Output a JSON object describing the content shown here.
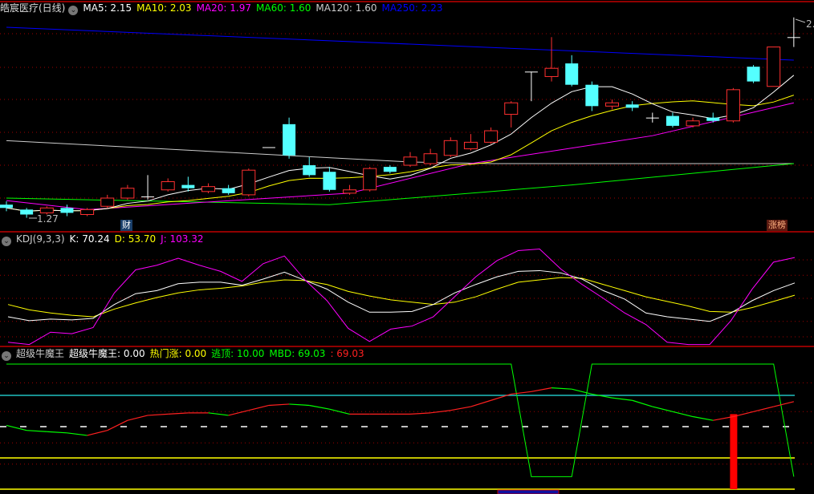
{
  "main": {
    "title": "皓宸医疗(日线)",
    "ma": [
      {
        "label": "MA5: 2.15",
        "color": "#ffffff"
      },
      {
        "label": "MA10: 2.03",
        "color": "#ffff00"
      },
      {
        "label": "MA20: 1.97",
        "color": "#ff00ff"
      },
      {
        "label": "MA60: 1.60",
        "color": "#00ff00"
      },
      {
        "label": "MA120: 1.60",
        "color": "#cccccc"
      },
      {
        "label": "MA250: 2.23",
        "color": "#0000ff"
      }
    ],
    "low_label": "1.27",
    "high_label": "2.",
    "badge_cai": "财",
    "badge_zhangbang": "涨榜",
    "candles": [
      [
        1.35,
        1.37,
        1.31,
        1.33
      ],
      [
        1.32,
        1.33,
        1.27,
        1.29
      ],
      [
        1.3,
        1.34,
        1.29,
        1.33
      ],
      [
        1.33,
        1.35,
        1.28,
        1.3
      ],
      [
        1.29,
        1.33,
        1.28,
        1.32
      ],
      [
        1.34,
        1.41,
        1.33,
        1.39
      ],
      [
        1.39,
        1.47,
        1.38,
        1.45
      ],
      [
        1.4,
        1.53,
        1.38,
        1.4
      ],
      [
        1.44,
        1.51,
        1.43,
        1.49
      ],
      [
        1.47,
        1.52,
        1.43,
        1.45
      ],
      [
        1.43,
        1.48,
        1.42,
        1.46
      ],
      [
        1.45,
        1.47,
        1.41,
        1.42
      ],
      [
        1.41,
        1.57,
        1.4,
        1.56
      ],
      [
        1.7,
        1.7,
        1.7,
        1.7
      ],
      [
        1.84,
        1.88,
        1.63,
        1.65
      ],
      [
        1.59,
        1.64,
        1.52,
        1.53
      ],
      [
        1.55,
        1.58,
        1.43,
        1.44
      ],
      [
        1.42,
        1.47,
        1.41,
        1.44
      ],
      [
        1.44,
        1.58,
        1.43,
        1.57
      ],
      [
        1.58,
        1.59,
        1.54,
        1.55
      ],
      [
        1.59,
        1.67,
        1.58,
        1.64
      ],
      [
        1.6,
        1.69,
        1.59,
        1.66
      ],
      [
        1.65,
        1.76,
        1.64,
        1.74
      ],
      [
        1.69,
        1.78,
        1.68,
        1.73
      ],
      [
        1.73,
        1.82,
        1.72,
        1.8
      ],
      [
        1.9,
        1.98,
        1.82,
        1.97
      ],
      [
        2.16,
        2.16,
        1.98,
        2.16
      ],
      [
        2.13,
        2.37,
        2.1,
        2.18
      ],
      [
        2.21,
        2.26,
        2.07,
        2.08
      ],
      [
        2.08,
        2.1,
        1.92,
        1.95
      ],
      [
        1.95,
        1.99,
        1.93,
        1.97
      ],
      [
        1.96,
        1.98,
        1.92,
        1.94
      ],
      [
        1.88,
        1.91,
        1.85,
        1.88
      ],
      [
        1.89,
        1.91,
        1.82,
        1.83
      ],
      [
        1.83,
        1.88,
        1.82,
        1.86
      ],
      [
        1.88,
        1.91,
        1.85,
        1.86
      ],
      [
        1.86,
        2.06,
        1.85,
        2.05
      ],
      [
        2.19,
        2.2,
        2.09,
        2.1
      ],
      [
        2.07,
        2.31,
        2.07,
        2.31
      ],
      [
        2.37,
        2.49,
        2.31,
        2.37
      ]
    ],
    "ma20_path": [
      [
        0,
        1.375
      ],
      [
        4,
        1.32
      ],
      [
        17,
        1.42
      ],
      [
        23,
        1.6
      ],
      [
        32,
        1.77
      ],
      [
        39,
        1.97
      ]
    ],
    "ma60_path": [
      [
        0,
        1.39
      ],
      [
        16,
        1.35
      ],
      [
        28,
        1.47
      ],
      [
        39,
        1.6
      ]
    ],
    "ma120_path": [
      [
        0,
        1.74
      ],
      [
        20,
        1.61
      ],
      [
        24,
        1.6
      ],
      [
        39,
        1.6
      ]
    ],
    "ma250_path": [
      [
        0,
        2.43
      ],
      [
        39,
        2.23
      ]
    ]
  },
  "kdj": {
    "title": "KDJ(9,3,3)",
    "k_label": "K: 70.24",
    "d_label": "D: 53.70",
    "j_label": "J: 103.32",
    "colors": {
      "k": "#ffffff",
      "d": "#ffff00",
      "j": "#ff00ff"
    },
    "K": [
      26,
      21,
      23,
      22,
      24,
      42,
      56,
      60,
      69,
      71,
      71,
      67,
      75,
      84,
      73,
      62,
      45,
      32,
      32,
      33,
      42,
      57,
      68,
      78,
      85,
      86,
      83,
      75,
      60,
      49,
      31,
      26,
      23,
      20,
      31,
      47,
      60,
      70
    ],
    "D": [
      42,
      35,
      31,
      28,
      26,
      36,
      44,
      51,
      57,
      61,
      63,
      66,
      71,
      74,
      73,
      68,
      59,
      53,
      48,
      45,
      42,
      45,
      52,
      62,
      71,
      74,
      77,
      76,
      68,
      60,
      52,
      46,
      40,
      33,
      32,
      38,
      46,
      54
    ],
    "J": [
      -7,
      -10,
      6,
      4,
      12,
      57,
      87,
      93,
      102,
      93,
      85,
      72,
      95,
      105,
      73,
      47,
      11,
      -6,
      10,
      14,
      26,
      52,
      78,
      99,
      112,
      114,
      88,
      68,
      50,
      31,
      16,
      -7,
      -10,
      -10,
      21,
      62,
      97,
      103
    ]
  },
  "niumowang": {
    "title": "超级牛魔王",
    "labels": [
      {
        "text": "超级牛魔王: 0.00",
        "color": "#ffffff"
      },
      {
        "text": "热门涨: 0.00",
        "color": "#ffff00"
      },
      {
        "text": "逃顶: 10.00",
        "color": "#00ff00"
      },
      {
        "text": "MBD: 69.03",
        "color": "#00ff00"
      },
      {
        "text": ": 69.03",
        "color": "#ff2020"
      }
    ],
    "mbd": [
      51,
      47,
      46,
      45,
      43,
      47,
      55,
      59,
      60,
      61,
      61,
      59,
      63,
      67,
      68,
      67,
      64,
      60,
      60,
      60,
      60,
      61,
      63,
      66,
      71,
      76,
      78,
      81,
      80,
      76,
      73,
      71,
      66,
      62,
      58,
      55,
      58,
      62,
      66,
      70
    ],
    "taoding": [
      100,
      100,
      100,
      100,
      100,
      100,
      100,
      100,
      100,
      100,
      100,
      100,
      100,
      100,
      100,
      100,
      100,
      100,
      100,
      100,
      100,
      100,
      100,
      100,
      100,
      100,
      10,
      10,
      10,
      100,
      100,
      100,
      100,
      100,
      100,
      100,
      100,
      100,
      100,
      10
    ],
    "bars": [
      {
        "index": 36,
        "value": 60
      }
    ],
    "levels": [
      {
        "value": 75,
        "color": "#20c0c0"
      },
      {
        "value": 50,
        "color": "#ffffff",
        "dashed": true
      },
      {
        "value": 25,
        "color": "#ffff00"
      },
      {
        "value": 0,
        "color": "#ffff00"
      }
    ]
  }
}
